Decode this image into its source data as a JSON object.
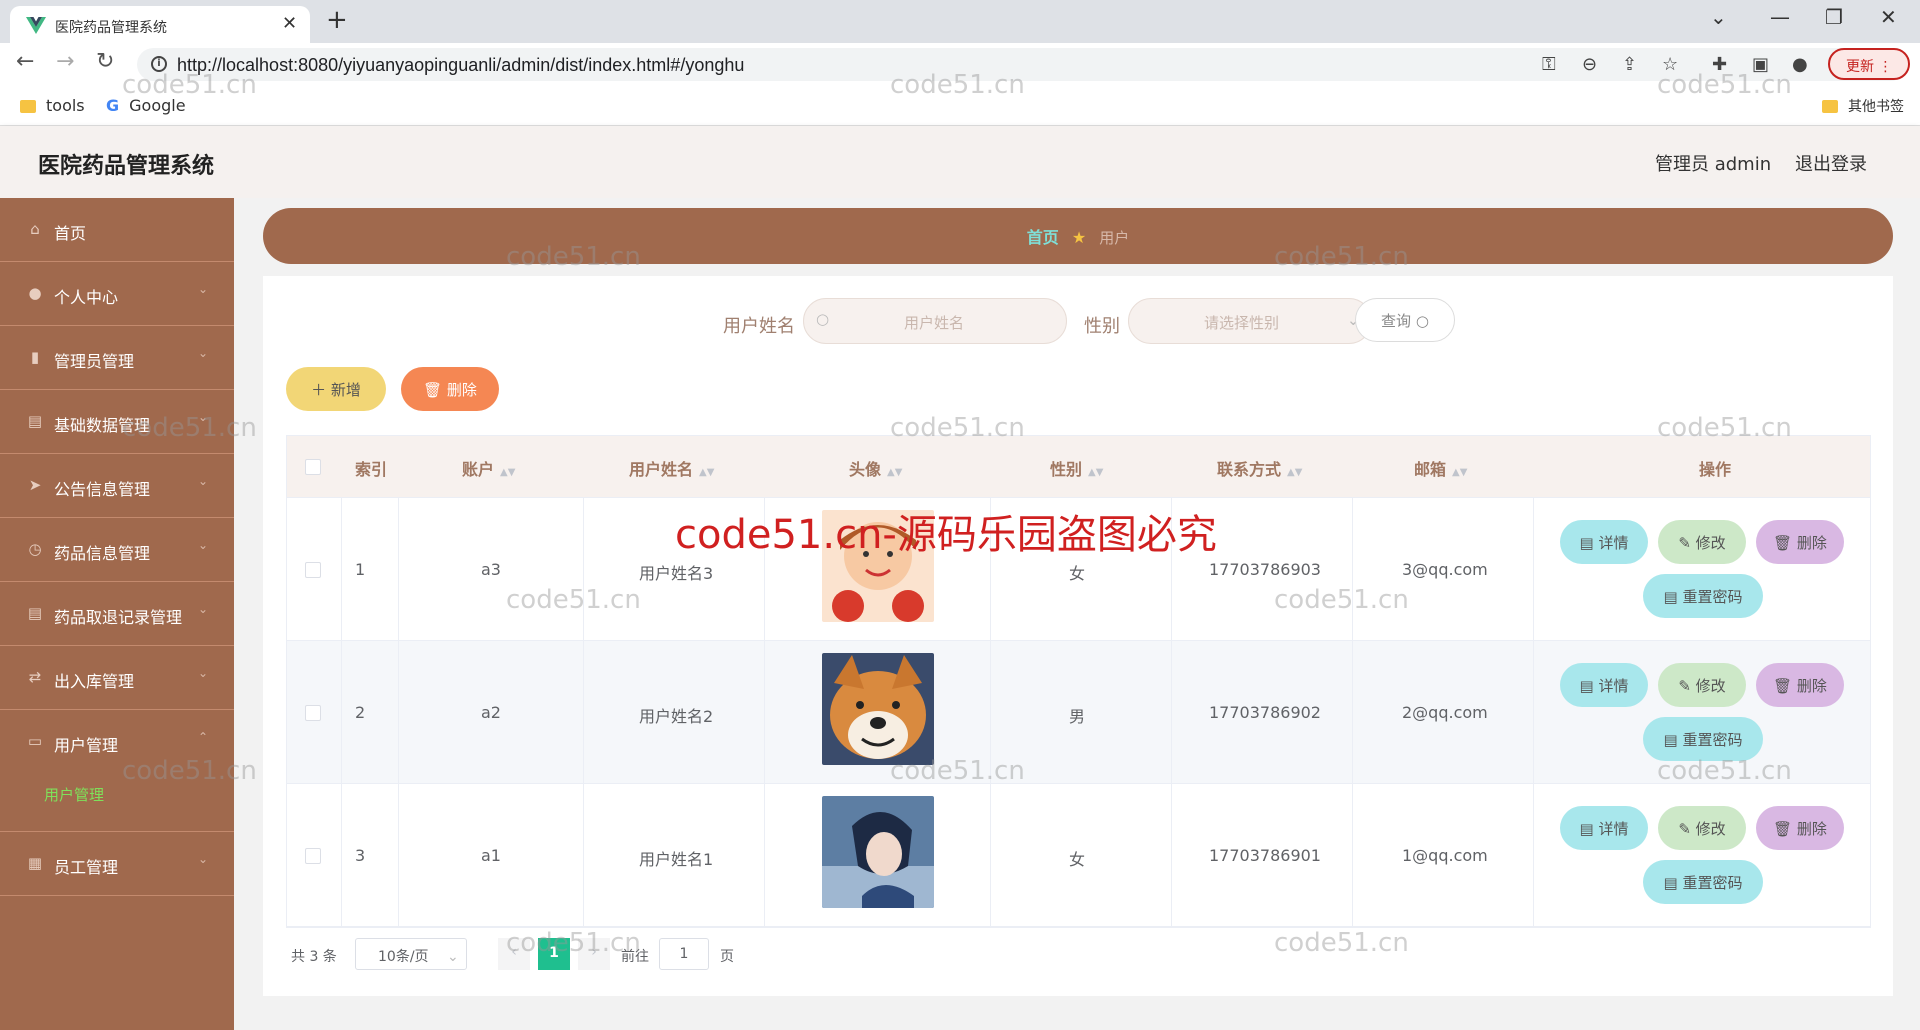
{
  "browser": {
    "tab_title": "医院药品管理系统",
    "url": "http://localhost:8080/yiyuanyaopinguanli/admin/dist/index.html#/yonghu",
    "update_label": "更新",
    "bookmarks": [
      "tools",
      "Google"
    ],
    "other_bookmarks": "其他书签"
  },
  "header": {
    "title": "医院药品管理系统",
    "admin": "管理员 admin",
    "logout": "退出登录"
  },
  "sidebar": {
    "items": [
      {
        "label": "首页",
        "icon": "home-icon"
      },
      {
        "label": "个人中心",
        "icon": "user-icon"
      },
      {
        "label": "管理员管理",
        "icon": "chart-icon"
      },
      {
        "label": "基础数据管理",
        "icon": "document-icon"
      },
      {
        "label": "公告信息管理",
        "icon": "send-icon"
      },
      {
        "label": "药品信息管理",
        "icon": "clock-icon"
      },
      {
        "label": "药品取退记录管理",
        "icon": "document-icon"
      },
      {
        "label": "出入库管理",
        "icon": "transfer-icon"
      },
      {
        "label": "用户管理",
        "icon": "message-icon"
      },
      {
        "label": "员工管理",
        "icon": "grid-icon"
      }
    ],
    "active_sub": "用户管理"
  },
  "breadcrumb": {
    "home": "首页",
    "current": "用户"
  },
  "search": {
    "name_label": "用户姓名",
    "name_placeholder": "用户姓名",
    "gender_label": "性别",
    "gender_placeholder": "请选择性别",
    "query_label": "查询"
  },
  "actions": {
    "add_label": "新增",
    "delete_label": "删除"
  },
  "table": {
    "columns": [
      "索引",
      "账户",
      "用户姓名",
      "头像",
      "性别",
      "联系方式",
      "邮箱",
      "操作"
    ],
    "rows": [
      {
        "index": "1",
        "account": "a3",
        "name": "用户姓名3",
        "gender": "女",
        "phone": "17703786903",
        "email": "3@qq.com"
      },
      {
        "index": "2",
        "account": "a2",
        "name": "用户姓名2",
        "gender": "男",
        "phone": "17703786902",
        "email": "2@qq.com"
      },
      {
        "index": "3",
        "account": "a1",
        "name": "用户姓名1",
        "gender": "女",
        "phone": "17703786901",
        "email": "1@qq.com"
      }
    ],
    "row_actions": {
      "detail": "详情",
      "edit": "修改",
      "delete": "删除",
      "reset": "重置密码"
    }
  },
  "pagination": {
    "total": "共 3 条",
    "page_size": "10条/页",
    "current": "1",
    "goto": "前往",
    "goto_value": "1",
    "page_unit": "页"
  },
  "watermark": {
    "small": "code51.cn",
    "big": "code51.cn-源码乐园盗图必究"
  },
  "colors": {
    "sidebar": "#a0694d",
    "accent_green": "#1fbf8f",
    "add_button": "#f2d676",
    "delete_button": "#f58753"
  }
}
